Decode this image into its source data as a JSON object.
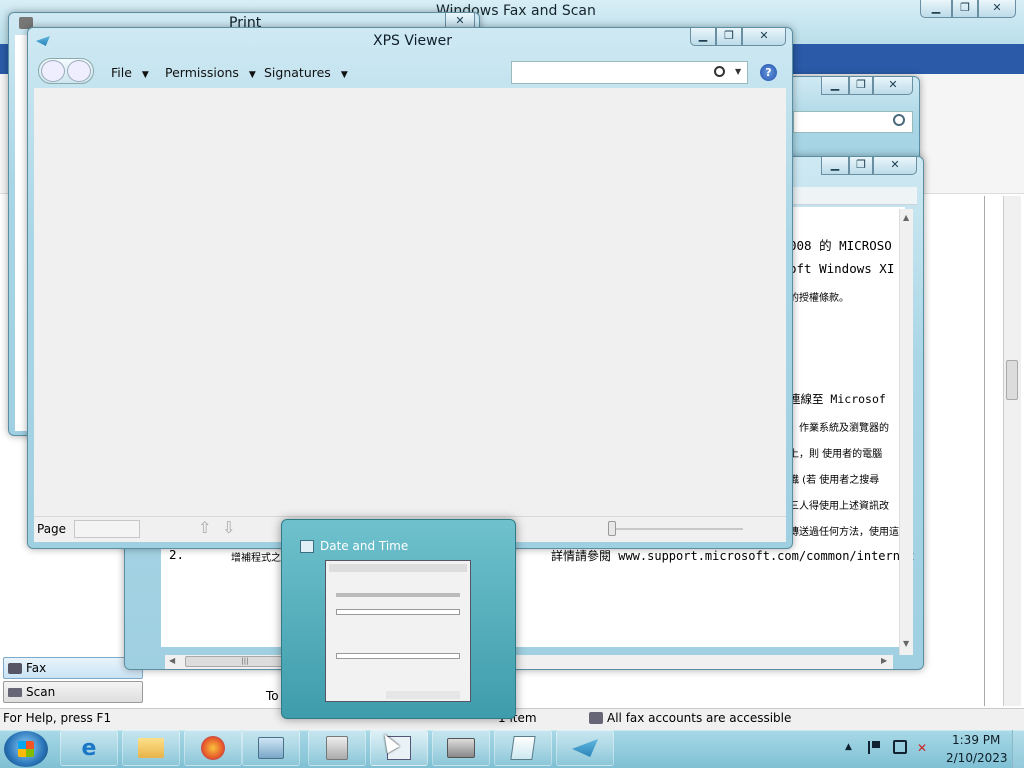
{
  "windows": {
    "fax_scan": {
      "title": "Windows Fax and Scan",
      "title_prefix_hidden": "Win",
      "title_visible": "ows Fax and Scan",
      "sidebar": [
        {
          "label": "Fax"
        },
        {
          "label": "Scan"
        }
      ],
      "status_left": "For Help, press F1",
      "status_count": "1 item",
      "status_accounts": "All fax accounts are accessible",
      "column_partial": "To",
      "item_count_partial": "1 i"
    },
    "print": {
      "title": "Print"
    },
    "xps": {
      "title": "XPS Viewer",
      "menu": [
        "File",
        "Permissions",
        "Signatures"
      ],
      "page_label": "Page",
      "search_placeholder": ""
    },
    "document": {
      "lines": [
        "008 的 MICROSO",
        "oft Windows XI",
        "的授權條款。",
        "連線至 Microsof",
        "、作業系統及瀏覽器的",
        "上，則 使用者的電腦",
        "職 (若 使用者之搜尋",
        "三人得使用上述資訊改",
        "傳送過任何方法，使用這"
      ],
      "numbered_item": {
        "number": "2.",
        "left_text": "增補程式之",
        "right_text": "詳情請參閱 www.support.microsoft.com/common/internat"
      }
    }
  },
  "preview": {
    "title": "Date and Time"
  },
  "taskbar": {
    "time": "1:39 PM",
    "date": "2/10/2023"
  }
}
